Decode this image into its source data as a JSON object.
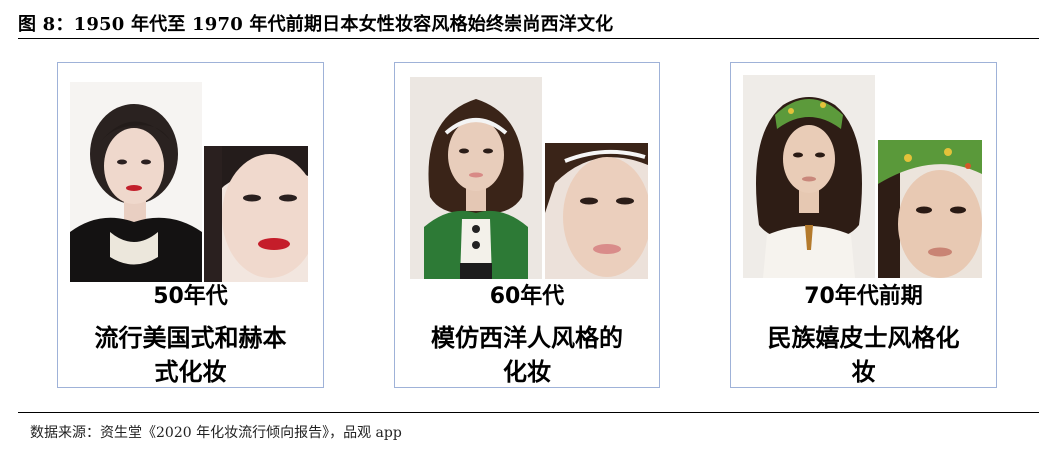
{
  "figure": {
    "title": "图 8：1950 年代至 1970 年代前期日本女性妆容风格始终崇尚西洋文化",
    "source": "数据来源：资生堂《2020 年化妆流行倾向报告》，品观 app"
  },
  "cards": [
    {
      "era": "50年代",
      "desc_line1": "流行美国式和赫本",
      "desc_line2": "式化妆"
    },
    {
      "era": "60年代",
      "desc_line1": "模仿西洋人风格的",
      "desc_line2": "化妆"
    },
    {
      "era": "70年代前期",
      "desc_line1": "民族嬉皮士风格化",
      "desc_line2": "妆"
    }
  ]
}
